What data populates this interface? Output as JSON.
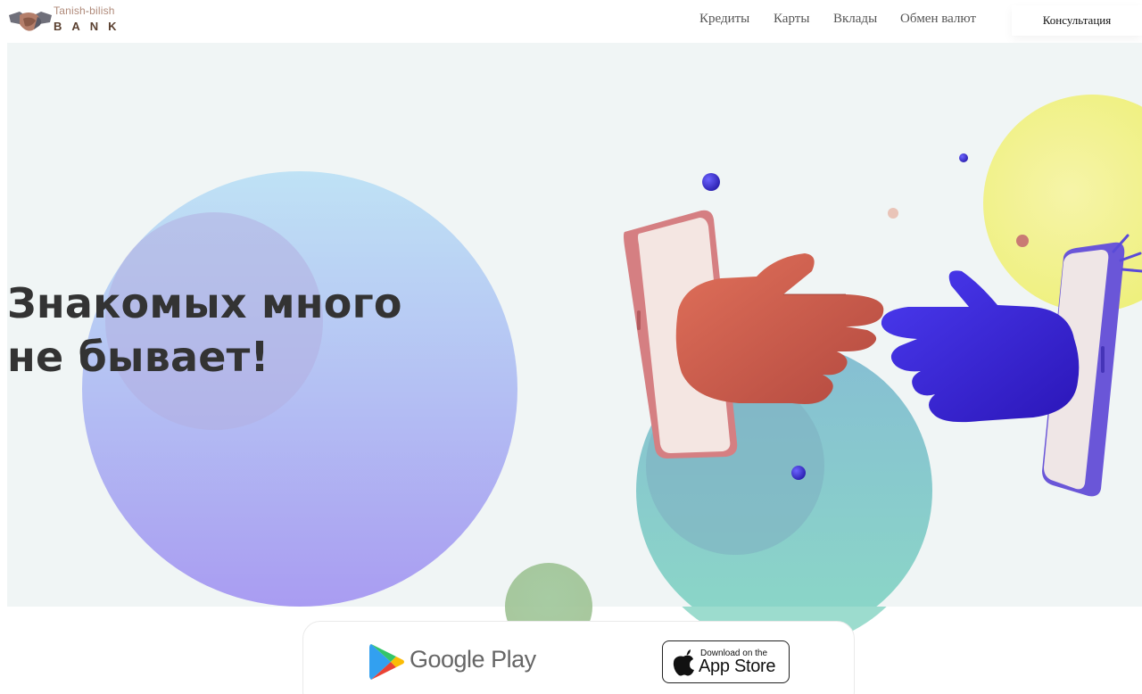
{
  "header": {
    "logo": {
      "top_text": "Tanish",
      "top_dash": "-",
      "top_text2": "bilish",
      "bottom_text": "BANK"
    },
    "nav": [
      {
        "label": "Кредиты"
      },
      {
        "label": "Карты"
      },
      {
        "label": "Вклады"
      },
      {
        "label": "Обмен валют"
      }
    ],
    "cta_label": "Консультация"
  },
  "hero": {
    "headline_line1": "Знакомых много",
    "headline_line2": "не бывает!"
  },
  "stores": {
    "google_play_label": "Google Play",
    "app_store_small": "Download on the",
    "app_store_big": "App Store"
  },
  "colors": {
    "hand_left": "#c75a4a",
    "hand_right": "#3b22d6",
    "yellow": "#f3f08a",
    "teal": "#8fd3cf",
    "violet": "#a79df2"
  }
}
